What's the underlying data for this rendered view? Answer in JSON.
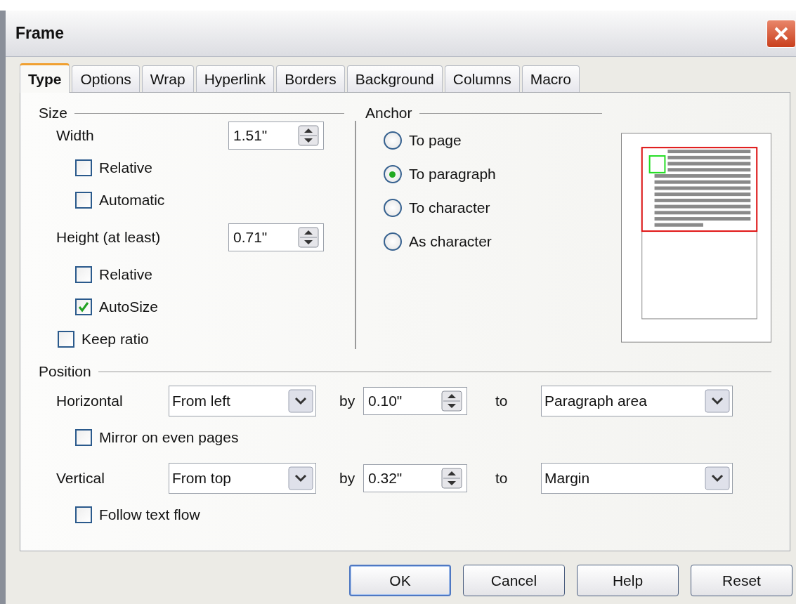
{
  "window": {
    "title": "Frame"
  },
  "tabs": [
    {
      "label": "Type",
      "selected": true
    },
    {
      "label": "Options",
      "selected": false
    },
    {
      "label": "Wrap",
      "selected": false
    },
    {
      "label": "Hyperlink",
      "selected": false
    },
    {
      "label": "Borders",
      "selected": false
    },
    {
      "label": "Background",
      "selected": false
    },
    {
      "label": "Columns",
      "selected": false
    },
    {
      "label": "Macro",
      "selected": false
    }
  ],
  "size": {
    "title": "Size",
    "width": {
      "label": "Width",
      "value": "1.51\""
    },
    "width_options": [
      {
        "label": "Relative",
        "checked": false
      },
      {
        "label": "Automatic",
        "checked": false
      }
    ],
    "height": {
      "label": "Height (at least)",
      "value": "0.71\""
    },
    "height_options": [
      {
        "label": "Relative",
        "checked": false
      },
      {
        "label": "AutoSize",
        "checked": true
      }
    ],
    "keep_ratio": {
      "label": "Keep ratio",
      "checked": false
    }
  },
  "anchor": {
    "title": "Anchor",
    "options": [
      {
        "label": "To page",
        "selected": false
      },
      {
        "label": "To paragraph",
        "selected": true
      },
      {
        "label": "To character",
        "selected": false
      },
      {
        "label": "As character",
        "selected": false
      }
    ]
  },
  "position": {
    "title": "Position",
    "rows": [
      {
        "label": "Horizontal",
        "from": "From left",
        "by_label": "by",
        "by": "0.10\"",
        "to_label": "to",
        "to": "Paragraph area",
        "option": {
          "label": "Mirror on even pages",
          "checked": false
        }
      },
      {
        "label": "Vertical",
        "from": "From top",
        "by_label": "by",
        "by": "0.32\"",
        "to_label": "to",
        "to": "Margin",
        "option": {
          "label": "Follow text flow",
          "checked": false
        }
      }
    ]
  },
  "buttons": [
    {
      "label": "OK",
      "default": true
    },
    {
      "label": "Cancel",
      "default": false
    },
    {
      "label": "Help",
      "default": false
    },
    {
      "label": "Reset",
      "default": false
    }
  ]
}
